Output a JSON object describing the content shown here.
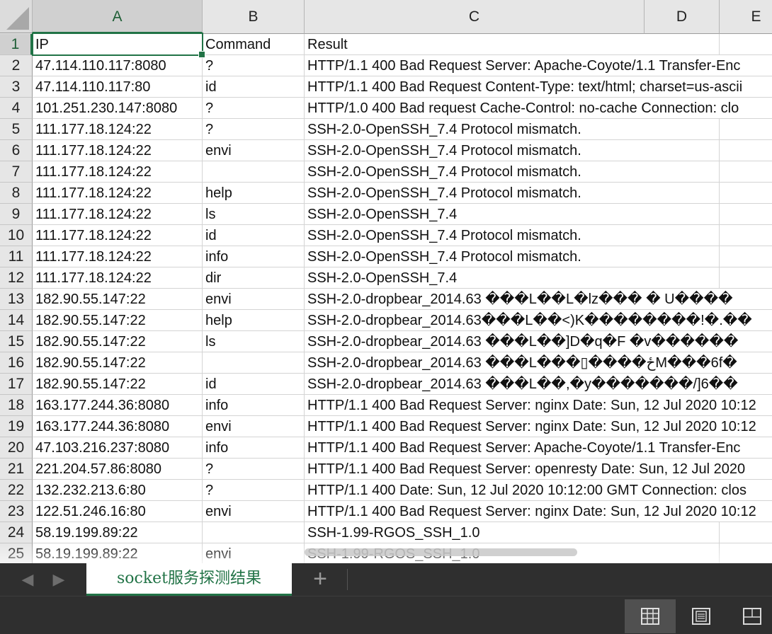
{
  "columns": [
    "A",
    "B",
    "C",
    "D",
    "E"
  ],
  "rows": [
    {
      "n": "1",
      "ip": "IP",
      "cmd": "Command",
      "res": "Result"
    },
    {
      "n": "2",
      "ip": "47.114.110.117:8080",
      "cmd": "?",
      "res": "HTTP/1.1 400 Bad Request  Server: Apache-Coyote/1.1  Transfer-Enc"
    },
    {
      "n": "3",
      "ip": "47.114.110.117:80",
      "cmd": "id",
      "res": "HTTP/1.1 400 Bad Request  Content-Type: text/html; charset=us-ascii"
    },
    {
      "n": "4",
      "ip": "101.251.230.147:8080",
      "cmd": "?",
      "res": "HTTP/1.0 400 Bad request  Cache-Control: no-cache  Connection: clo"
    },
    {
      "n": "5",
      "ip": "111.177.18.124:22",
      "cmd": "?",
      "res": "SSH-2.0-OpenSSH_7.4  Protocol mismatch."
    },
    {
      "n": "6",
      "ip": "111.177.18.124:22",
      "cmd": "envi",
      "res": "SSH-2.0-OpenSSH_7.4  Protocol mismatch."
    },
    {
      "n": "7",
      "ip": "111.177.18.124:22",
      "cmd": "",
      "res": "SSH-2.0-OpenSSH_7.4  Protocol mismatch."
    },
    {
      "n": "8",
      "ip": "111.177.18.124:22",
      "cmd": "help",
      "res": "SSH-2.0-OpenSSH_7.4  Protocol mismatch."
    },
    {
      "n": "9",
      "ip": "111.177.18.124:22",
      "cmd": "ls",
      "res": "SSH-2.0-OpenSSH_7.4"
    },
    {
      "n": "10",
      "ip": "111.177.18.124:22",
      "cmd": "id",
      "res": "SSH-2.0-OpenSSH_7.4  Protocol mismatch."
    },
    {
      "n": "11",
      "ip": "111.177.18.124:22",
      "cmd": "info",
      "res": "SSH-2.0-OpenSSH_7.4  Protocol mismatch."
    },
    {
      "n": "12",
      "ip": "111.177.18.124:22",
      "cmd": "dir",
      "res": "SSH-2.0-OpenSSH_7.4"
    },
    {
      "n": "13",
      "ip": "182.90.55.147:22",
      "cmd": "envi",
      "res": "SSH-2.0-dropbear_2014.63   ���L��L�lz��� �    U����"
    },
    {
      "n": "14",
      "ip": "182.90.55.147:22",
      "cmd": "help",
      "res": "SSH-2.0-dropbear_2014.63���L��<)K��������!�.��"
    },
    {
      "n": "15",
      "ip": "182.90.55.147:22",
      "cmd": "ls",
      "res": "SSH-2.0-dropbear_2014.63   ���L��]D�q�F �v������"
    },
    {
      "n": "16",
      "ip": "182.90.55.147:22",
      "cmd": "",
      "res": "SSH-2.0-dropbear_2014.63   ���L���▯����ځM���6f�"
    },
    {
      "n": "17",
      "ip": "182.90.55.147:22",
      "cmd": "id",
      "res": "SSH-2.0-dropbear_2014.63   ���L��,�y�������/]6��"
    },
    {
      "n": "18",
      "ip": "163.177.244.36:8080",
      "cmd": "info",
      "res": "HTTP/1.1 400 Bad Request  Server: nginx  Date: Sun, 12 Jul 2020 10:12"
    },
    {
      "n": "19",
      "ip": "163.177.244.36:8080",
      "cmd": "envi",
      "res": "HTTP/1.1 400 Bad Request  Server: nginx  Date: Sun, 12 Jul 2020 10:12"
    },
    {
      "n": "20",
      "ip": "47.103.216.237:8080",
      "cmd": "info",
      "res": "HTTP/1.1 400 Bad Request  Server: Apache-Coyote/1.1  Transfer-Enc"
    },
    {
      "n": "21",
      "ip": "221.204.57.86:8080",
      "cmd": "?",
      "res": "HTTP/1.1 400 Bad Request  Server: openresty  Date: Sun, 12 Jul 2020"
    },
    {
      "n": "22",
      "ip": "132.232.213.6:80",
      "cmd": "?",
      "res": "HTTP/1.1 400    Date: Sun, 12 Jul 2020 10:12:00 GMT  Connection: clos"
    },
    {
      "n": "23",
      "ip": "122.51.246.16:80",
      "cmd": "envi",
      "res": "HTTP/1.1 400 Bad Request  Server: nginx  Date: Sun, 12 Jul 2020 10:12"
    },
    {
      "n": "24",
      "ip": "58.19.199.89:22",
      "cmd": "",
      "res": "SSH-1.99-RGOS_SSH_1.0"
    },
    {
      "n": "25",
      "ip": "58.19.199.89:22",
      "cmd": "envi",
      "res": "SSH-1.99-RGOS_SSH_1.0"
    }
  ],
  "sheet_tabs": {
    "active": "socket服务探测结果",
    "add_label": "+",
    "prev_icon": "chevron-left-icon",
    "next_icon": "chevron-right-icon"
  },
  "view_buttons": [
    {
      "icon": "normal-view-icon",
      "active": true
    },
    {
      "icon": "page-layout-view-icon",
      "active": false
    },
    {
      "icon": "page-break-view-icon",
      "active": false
    }
  ],
  "colors": {
    "accent": "#217346",
    "header_bg": "#e6e6e6",
    "bar_bg": "#2f2f2f"
  }
}
